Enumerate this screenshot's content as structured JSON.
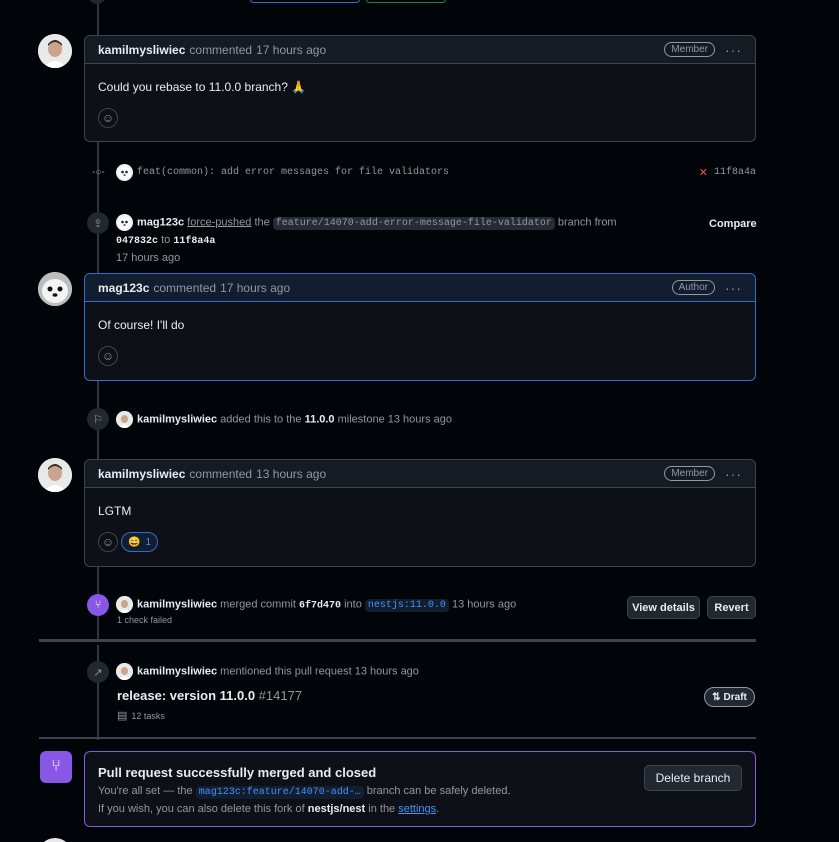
{
  "comment1": {
    "author": "kamilmysliwiec",
    "action": "commented",
    "time": "17 hours ago",
    "role": "Member",
    "body": "Could you rebase to 11.0.0 branch? 🙏"
  },
  "commit_event": {
    "message": "feat(common): add error messages for file validators",
    "status_icon": "x-icon",
    "sha": "11f8a4a"
  },
  "force_push_event": {
    "actor": "mag123c",
    "action": "force-pushed",
    "the": "the",
    "branch": "feature/14070-add-error-message-file-validator",
    "branch_word": "branch from",
    "from_sha": "047832c",
    "to_word": "to",
    "to_sha": "11f8a4a",
    "time": "17 hours ago",
    "compare_label": "Compare"
  },
  "comment2": {
    "author": "mag123c",
    "action": "commented",
    "time": "17 hours ago",
    "role": "Author",
    "body": "Of course! I'll do"
  },
  "milestone_event": {
    "actor": "kamilmysliwiec",
    "text_before": "added this to the",
    "milestone": "11.0.0",
    "text_after": "milestone",
    "time": "13 hours ago"
  },
  "comment3": {
    "author": "kamilmysliwiec",
    "action": "commented",
    "time": "13 hours ago",
    "role": "Member",
    "body": "LGTM",
    "reaction_emoji": "😄",
    "reaction_count": "1"
  },
  "merge_event": {
    "actor": "kamilmysliwiec",
    "text_merged": "merged commit",
    "commit": "6f7d470",
    "text_into": "into",
    "target": "nestjs:11.0.0",
    "time": "13 hours ago",
    "checks": "1 check failed",
    "view_details_label": "View details",
    "revert_label": "Revert"
  },
  "mention_event": {
    "actor": "kamilmysliwiec",
    "text": "mentioned this pull request",
    "time": "13 hours ago",
    "pr_title": "release: version 11.0.0",
    "pr_number": "#14177",
    "tasks": "12 tasks",
    "draft_label": "Draft"
  },
  "merged_box": {
    "title": "Pull request successfully merged and closed",
    "line1_before": "You're all set — the",
    "branch_chip": "mag123c:feature/14070-add-…",
    "line1_after": "branch can be safely deleted.",
    "line2_before": "If you wish, you can also delete this fork of",
    "repo": "nestjs/nest",
    "line2_mid": "in the",
    "settings_link": "settings",
    "period": ".",
    "delete_label": "Delete branch"
  },
  "colors": {
    "background": "#010409",
    "merged_purple": "#8957e5",
    "link_blue": "#4493f8",
    "author_border": "#316dca",
    "error_red": "#f85149"
  }
}
